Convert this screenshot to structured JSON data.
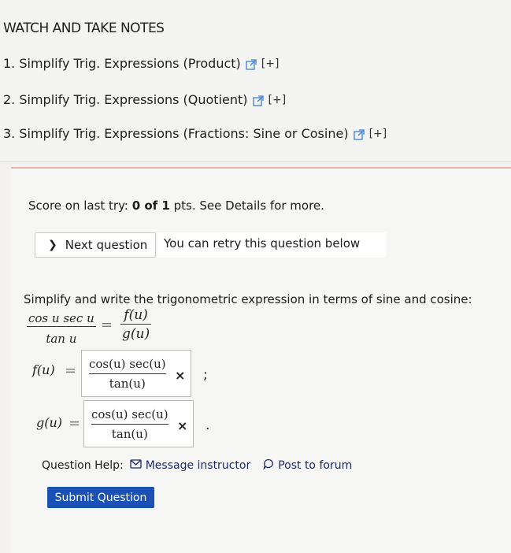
{
  "watch": {
    "title": "WATCH AND TAKE NOTES",
    "links": [
      {
        "label": "1. Simplify Trig. Expressions (Product)",
        "suffix": "[+]"
      },
      {
        "label": "2. Simplify Trig. Expressions (Quotient)",
        "suffix": "[+]"
      },
      {
        "label": "3. Simplify Trig. Expressions (Fractions: Sine or Cosine)",
        "suffix": "[+]"
      }
    ]
  },
  "score": {
    "prefix": "Score on last try: ",
    "value": "0 of 1",
    "suffix": " pts. See Details for more."
  },
  "next_button": {
    "label": "Next question"
  },
  "retry_text": "You can retry this question below",
  "question": {
    "instructions": "Simplify and write the trigonometric expression in terms of sine and cosine:",
    "lhs_num": "cos u sec u",
    "lhs_den": "tan u",
    "rhs_num": "f(u)",
    "rhs_den": "g(u)",
    "eq": "=",
    "f_label": "f(u)",
    "g_label": "g(u)",
    "f_answer_num": "cos(u) sec(u)",
    "f_answer_den": "tan(u)",
    "g_answer_num": "cos(u) sec(u)",
    "g_answer_den": "tan(u)",
    "f_mark": "×",
    "g_mark": "×",
    "f_trailing": ";",
    "g_trailing": "."
  },
  "help": {
    "label": "Question Help:",
    "message": "Message instructor",
    "forum": "Post to forum"
  },
  "submit": {
    "label": "Submit Question"
  },
  "colors": {
    "submit_bg": "#1b51b5",
    "divider": "#e8b3ad"
  }
}
